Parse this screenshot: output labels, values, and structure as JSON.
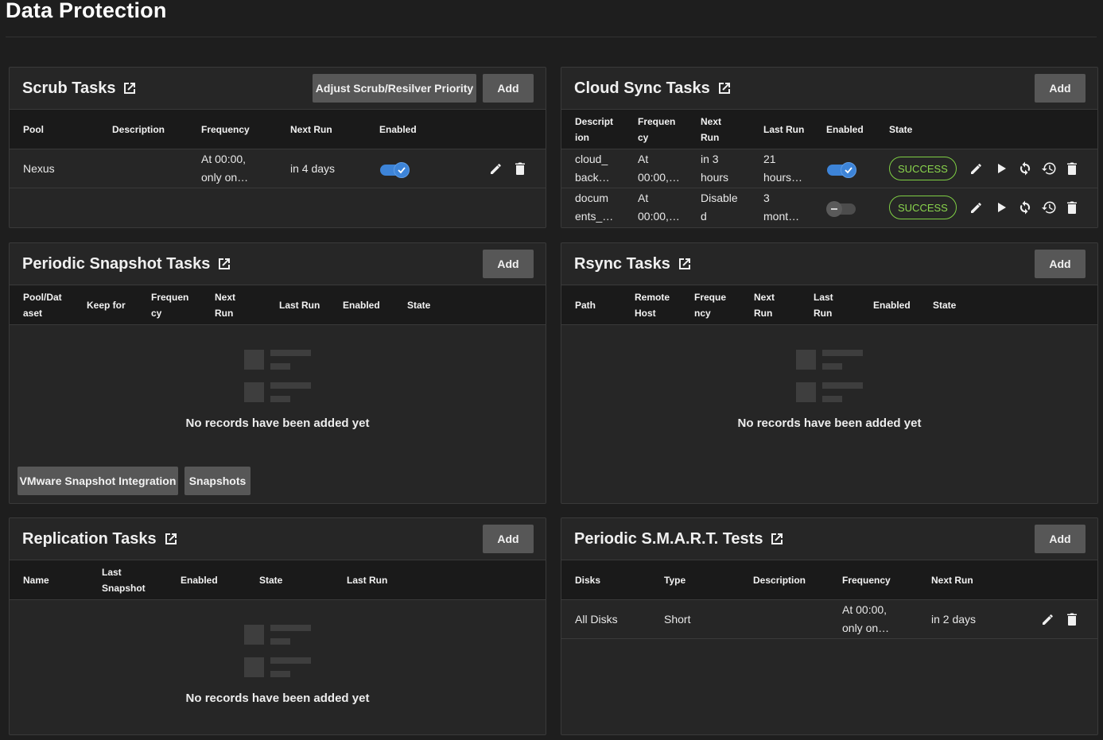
{
  "page": {
    "title": "Data Protection"
  },
  "colors": {
    "accent": "#3d84d8",
    "success": "#8ad54d",
    "button": "#575757"
  },
  "scrub": {
    "title": "Scrub Tasks",
    "priority_button": "Adjust Scrub/Resilver Priority",
    "add": "Add",
    "columns": [
      "Pool",
      "Description",
      "Frequency",
      "Next Run",
      "Enabled"
    ],
    "rows": [
      {
        "pool": "Nexus",
        "description": "",
        "frequency_1": "At 00:00,",
        "frequency_2": "only on…",
        "next_run": "in 4 days",
        "enabled": true
      }
    ]
  },
  "cloud": {
    "title": "Cloud Sync Tasks",
    "add": "Add",
    "columns": [
      [
        "Descript",
        "ion"
      ],
      [
        "Frequen",
        "cy"
      ],
      [
        "Next",
        "Run"
      ],
      [
        "Last Run"
      ],
      [
        "Enabled"
      ],
      [
        "State"
      ]
    ],
    "rows": [
      {
        "desc_1": "cloud_",
        "desc_2": "back…",
        "freq_1": "At",
        "freq_2": "00:00,…",
        "next_1": "in 3",
        "next_2": "hours",
        "last_1": "21",
        "last_2": "hours…",
        "enabled": true,
        "state": "SUCCESS"
      },
      {
        "desc_1": "docum",
        "desc_2": "ents_…",
        "freq_1": "At",
        "freq_2": "00:00,…",
        "next_1": "Disable",
        "next_2": "d",
        "last_1": "3",
        "last_2": "mont…",
        "enabled": false,
        "state": "SUCCESS"
      }
    ]
  },
  "snapshot": {
    "title": "Periodic Snapshot Tasks",
    "add": "Add",
    "columns": [
      [
        "Pool/Dat",
        "aset"
      ],
      [
        "Keep for"
      ],
      [
        "Frequen",
        "cy"
      ],
      [
        "Next",
        "Run"
      ],
      [
        "Last Run"
      ],
      [
        "Enabled"
      ],
      [
        "State"
      ]
    ],
    "empty": "No records have been added yet",
    "vmware_button": "VMware Snapshot Integration",
    "snapshots_button": "Snapshots"
  },
  "rsync": {
    "title": "Rsync Tasks",
    "add": "Add",
    "columns": [
      [
        "Path"
      ],
      [
        "Remote",
        "Host"
      ],
      [
        "Freque",
        "ncy"
      ],
      [
        "Next",
        "Run"
      ],
      [
        "Last",
        "Run"
      ],
      [
        "Enabled"
      ],
      [
        "State"
      ]
    ],
    "empty": "No records have been added yet"
  },
  "replication": {
    "title": "Replication Tasks",
    "add": "Add",
    "columns": [
      [
        "Name"
      ],
      [
        "Last",
        "Snapshot"
      ],
      [
        "Enabled"
      ],
      [
        "State"
      ],
      [
        "Last Run"
      ]
    ],
    "empty": "No records have been added yet"
  },
  "smart": {
    "title": "Periodic S.M.A.R.T. Tests",
    "add": "Add",
    "columns": [
      "Disks",
      "Type",
      "Description",
      "Frequency",
      "Next Run"
    ],
    "rows": [
      {
        "disks": "All Disks",
        "type": "Short",
        "description": "",
        "frequency_1": "At 00:00,",
        "frequency_2": "only on…",
        "next_run": "in 2 days"
      }
    ]
  }
}
